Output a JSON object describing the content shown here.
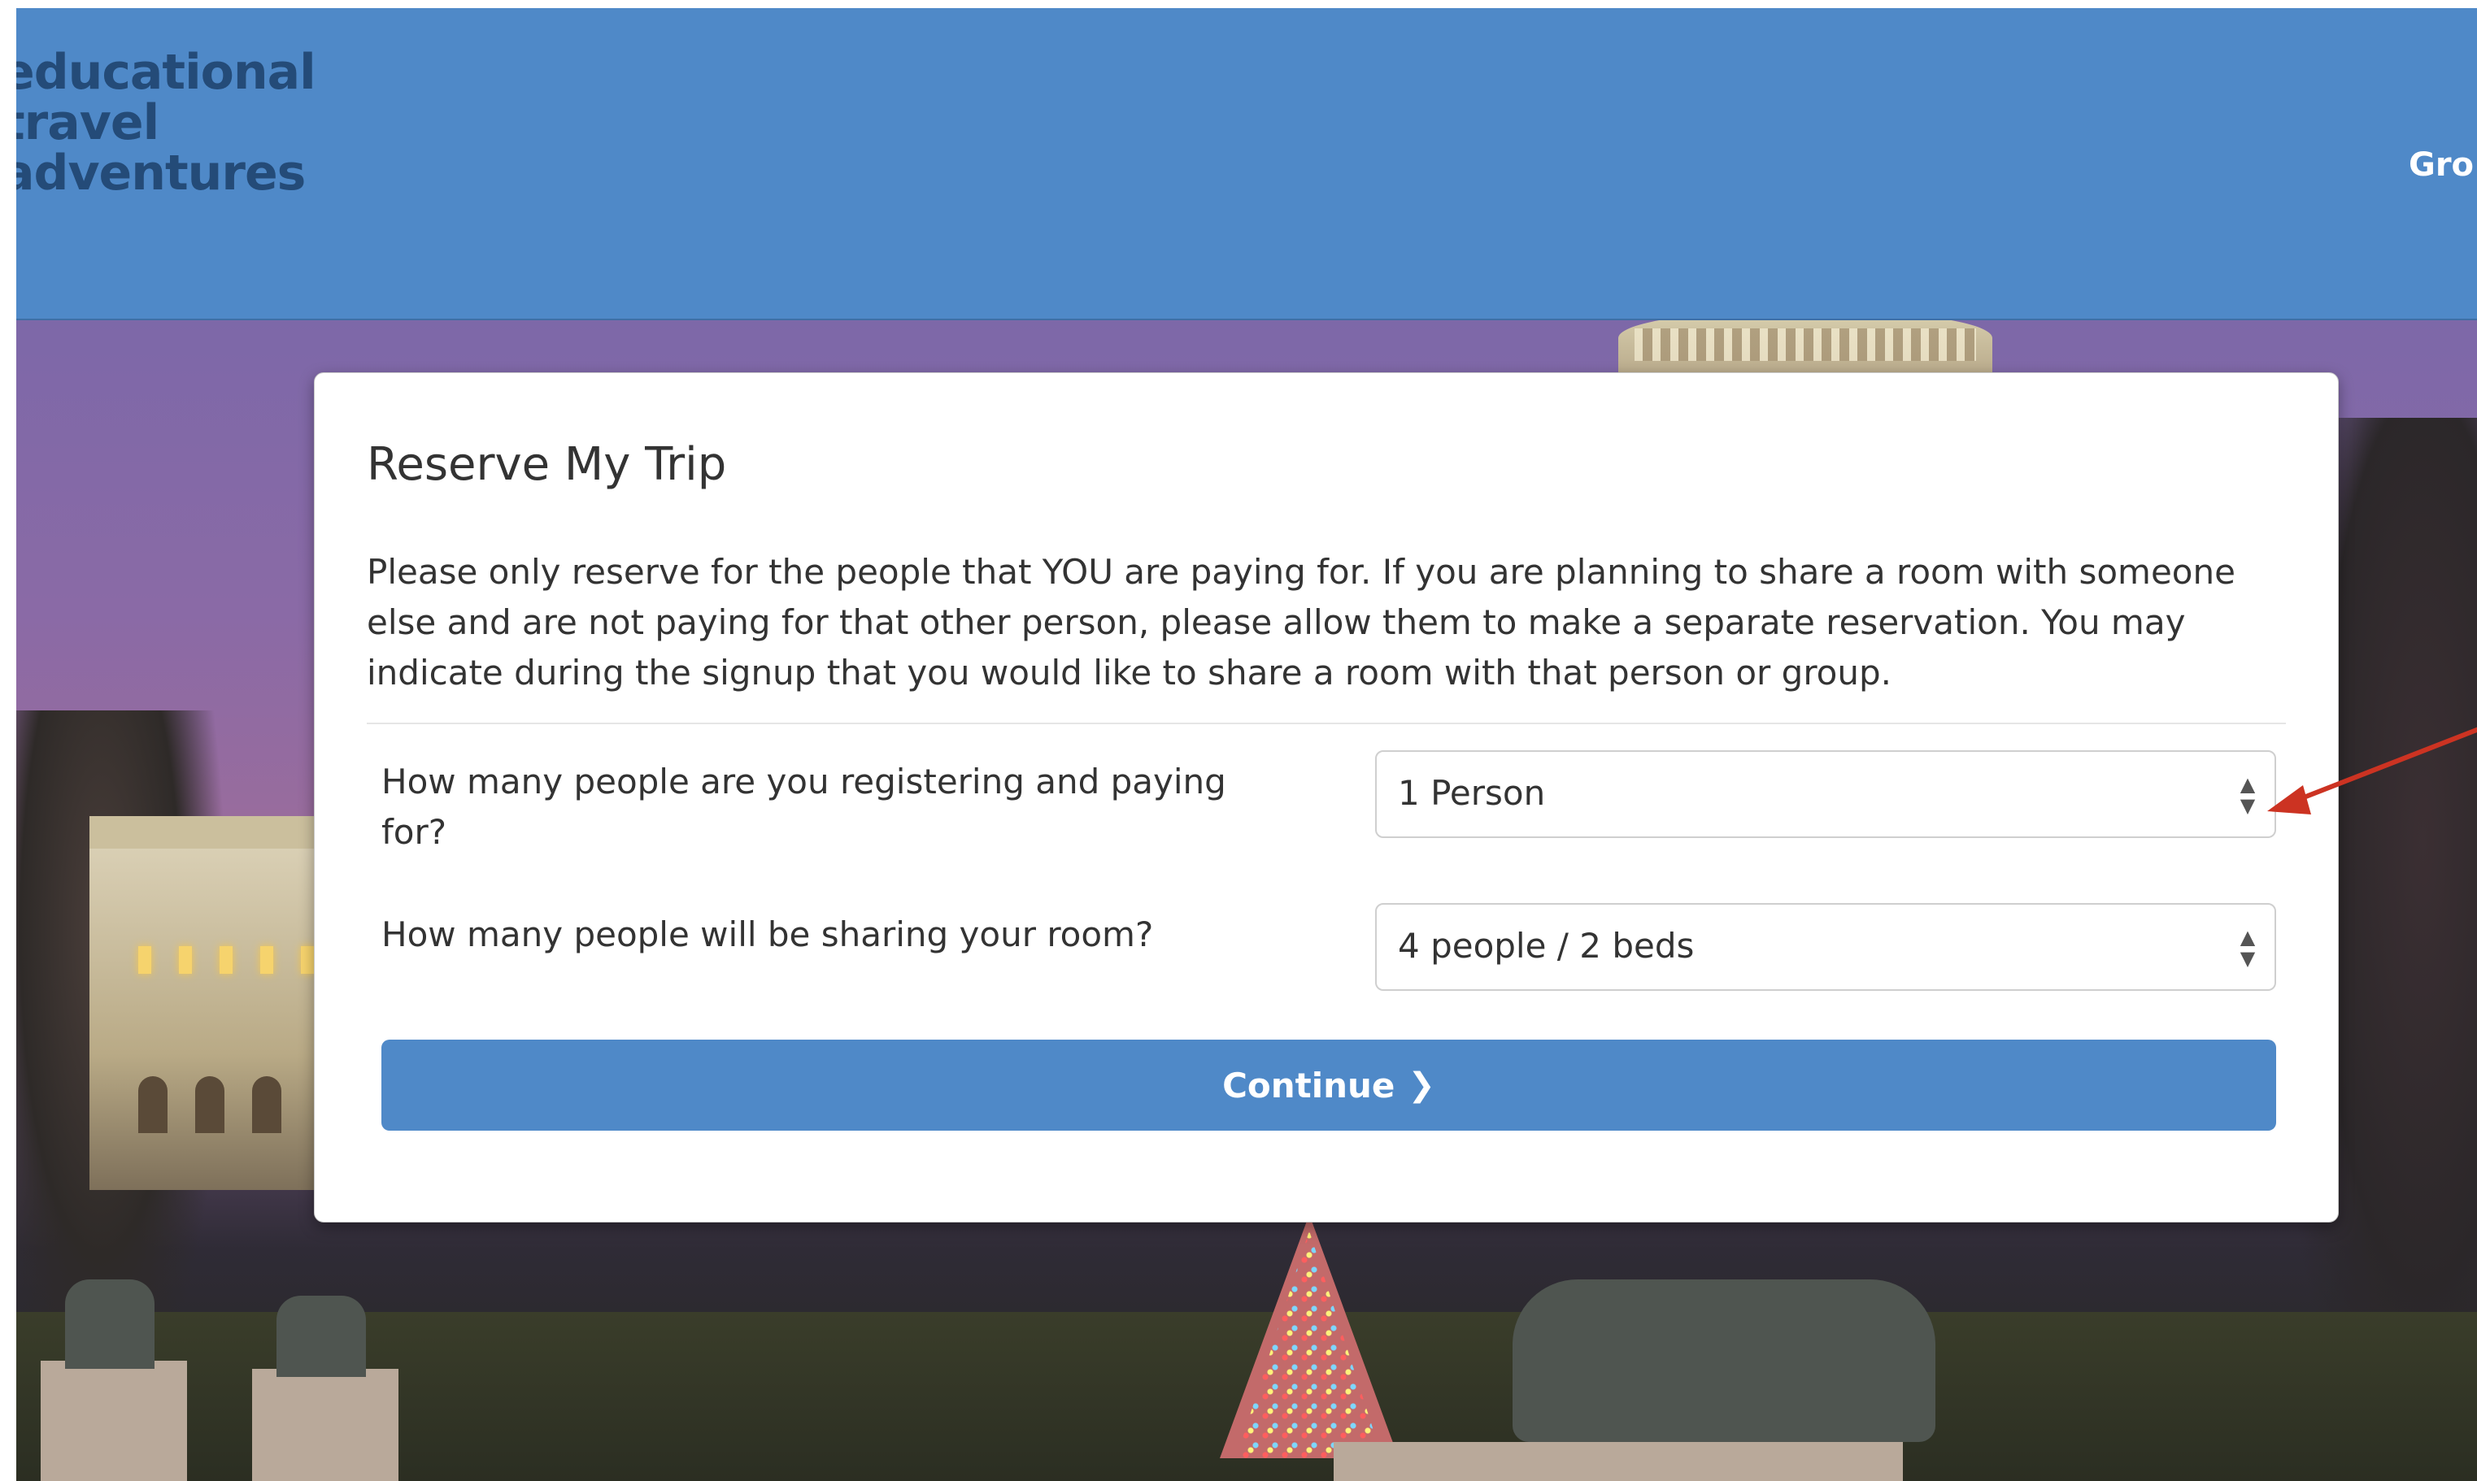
{
  "header": {
    "logo_lines": [
      "educational",
      "travel",
      "adventures"
    ],
    "nav_link": "Gro"
  },
  "modal": {
    "title": "Reserve My Trip",
    "description": "Please only reserve for the people that YOU are paying for. If you are planning to share a room with someone else and are not paying for that other person, please allow them to make a separate reservation. You may indicate during the signup that you would like to share a room with that person or group.",
    "question_people": "How many people are you registering and paying for?",
    "people_select_value": "1 Person",
    "question_room": "How many people will be sharing your room?",
    "room_select_value": "4 people / 2 beds",
    "continue_label": "Continue",
    "continue_icon": "chevron-right-icon"
  },
  "colors": {
    "header_blue": "#4f89c8",
    "button_blue": "#4f89c8",
    "annotation_red": "#cc3322"
  }
}
